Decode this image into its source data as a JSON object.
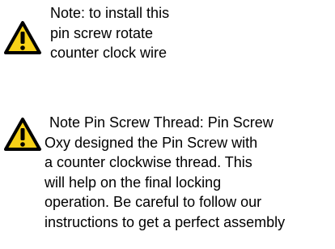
{
  "notes": [
    {
      "icon": "warning-icon",
      "lines": [
        "Note: to install this",
        "pin screw rotate",
        "counter clock wire"
      ]
    },
    {
      "icon": "warning-icon",
      "lines": [
        "Note Pin Screw Thread: Pin Screw",
        "Oxy designed the Pin Screw with",
        "a counter clockwise thread. This",
        "will help on the final locking",
        "operation. Be careful to follow our",
        "instructions to get a perfect assembly"
      ]
    }
  ],
  "colors": {
    "icon_fill": "#f7d117",
    "icon_stroke": "#000000",
    "text": "#000000",
    "background": "#ffffff"
  }
}
